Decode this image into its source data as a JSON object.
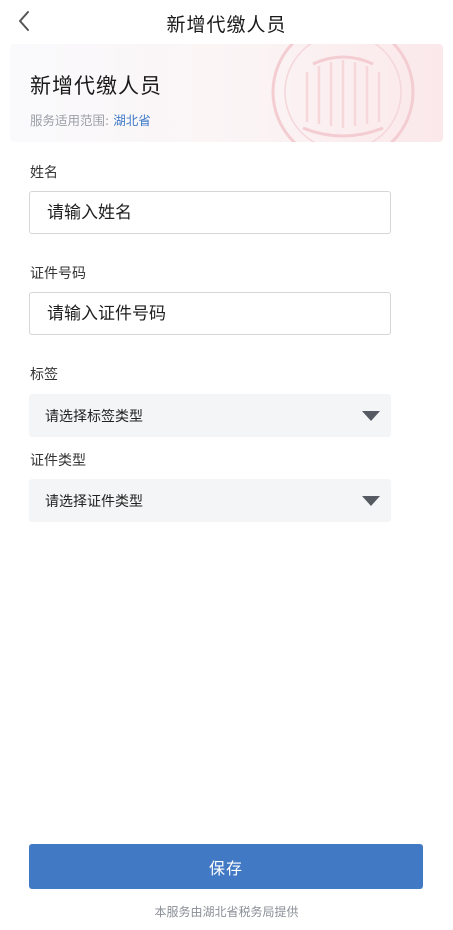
{
  "navbar": {
    "title": "新增代缴人员",
    "back_icon": "chevron-left-icon"
  },
  "banner": {
    "title": "新增代缴人员",
    "scope_label": "服务适用范围:",
    "scope_value": "湖北省",
    "watermark_icon": "tax-seal-watermark"
  },
  "form": {
    "name": {
      "label": "姓名",
      "placeholder": "请输入姓名",
      "value": ""
    },
    "id_number": {
      "label": "证件号码",
      "placeholder": "请输入证件号码",
      "value": ""
    },
    "tag": {
      "label": "标签",
      "selected_text": "请选择标签类型",
      "arrow_icon": "triangle-down-icon"
    },
    "id_type": {
      "label": "证件类型",
      "selected_text": "请选择证件类型",
      "arrow_icon": "triangle-down-icon"
    }
  },
  "actions": {
    "save_label": "保存"
  },
  "footer": {
    "text": "本服务由湖北省税务局提供"
  },
  "colors": {
    "accent": "#4179c4",
    "scope_link": "#3d7ac8",
    "banner_gradient_end": "#fbe8ea",
    "select_bg": "#f4f5f7"
  }
}
